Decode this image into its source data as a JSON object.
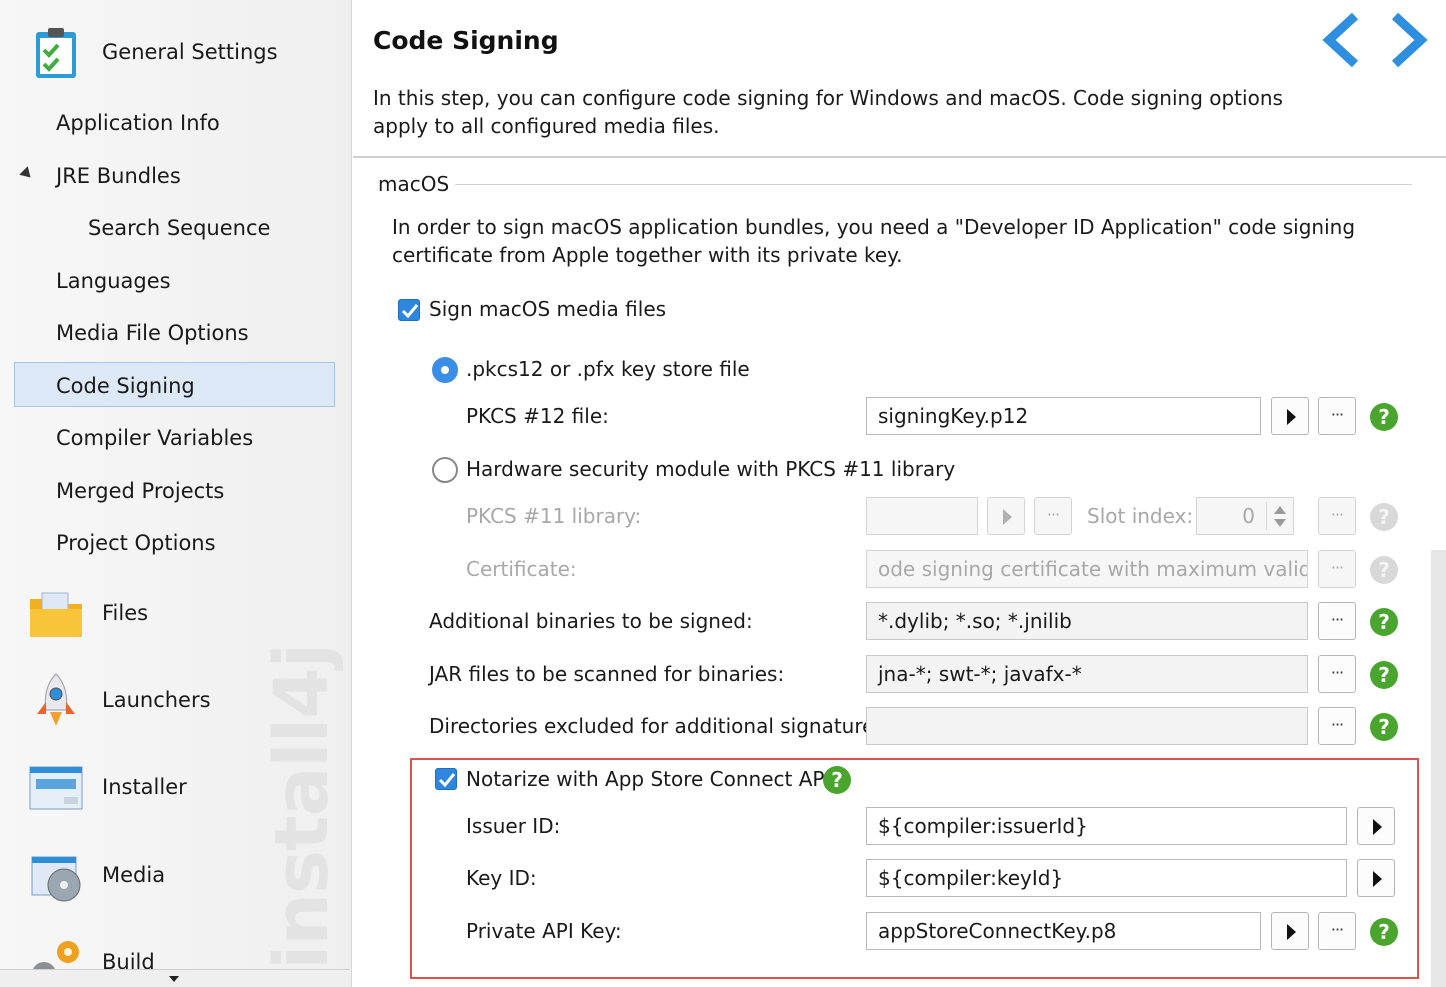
{
  "sidebar": {
    "watermark": "install4j",
    "groups": [
      {
        "label": "General Settings",
        "icon": "clipboard-check-icon"
      },
      {
        "label": "Files",
        "icon": "folder-icon"
      },
      {
        "label": "Launchers",
        "icon": "rocket-icon"
      },
      {
        "label": "Installer",
        "icon": "installer-window-icon"
      },
      {
        "label": "Media",
        "icon": "media-disc-icon"
      },
      {
        "label": "Build",
        "icon": "build-gears-icon"
      }
    ],
    "items": [
      {
        "label": "Application Info"
      },
      {
        "label": "JRE Bundles",
        "expanded": true
      },
      {
        "label": "Search Sequence"
      },
      {
        "label": "Languages"
      },
      {
        "label": "Media File Options"
      },
      {
        "label": "Code Signing",
        "selected": true
      },
      {
        "label": "Compiler Variables"
      },
      {
        "label": "Merged Projects"
      },
      {
        "label": "Project Options"
      }
    ]
  },
  "header": {
    "title": "Code Signing",
    "description": "In this step, you can configure code signing for Windows and macOS. Code signing options apply to all configured media files.",
    "back_icon": "chevron-left-icon",
    "forward_icon": "chevron-right-icon",
    "accent": "#2e8fe0"
  },
  "macos": {
    "legend": "macOS",
    "intro": "In order to sign macOS application bundles, you need a \"Developer ID Application\" code signing certificate from Apple together with its private key.",
    "sign_checkbox": {
      "label": "Sign macOS media files",
      "checked": true
    },
    "keystore_radio": {
      "label": ".pkcs12 or .pfx key store file",
      "selected": true
    },
    "pkcs12": {
      "label": "PKCS #12 file:",
      "value": "signingKey.p12"
    },
    "hsm_radio": {
      "label": "Hardware security module with PKCS #11 library",
      "selected": false
    },
    "pkcs11": {
      "label": "PKCS #11 library:",
      "value": ""
    },
    "slot": {
      "label": "Slot index:",
      "value": "0"
    },
    "certificate": {
      "label": "Certificate:",
      "value": "ode signing certificate with maximum validity"
    },
    "additional_binaries": {
      "label": "Additional binaries to be signed:",
      "value": "*.dylib; *.so; *.jnilib"
    },
    "jar_files": {
      "label": "JAR files to be scanned for binaries:",
      "value": "jna-*; swt-*; javafx-*"
    },
    "excluded_dirs": {
      "label": "Directories excluded for additional signatures:",
      "value": ""
    },
    "notarize": {
      "checkbox_label": "Notarize with App Store Connect API",
      "checked": true,
      "issuer": {
        "label": "Issuer ID:",
        "value": "${compiler:issuerId}"
      },
      "key_id": {
        "label": "Key ID:",
        "value": "${compiler:keyId}"
      },
      "private_key": {
        "label": "Private API Key:",
        "value": "appStoreConnectKey.p8"
      },
      "highlight_color": "#d9534f"
    },
    "browse_label": "···",
    "help_label": "?",
    "help_color": "#4aa52e"
  }
}
